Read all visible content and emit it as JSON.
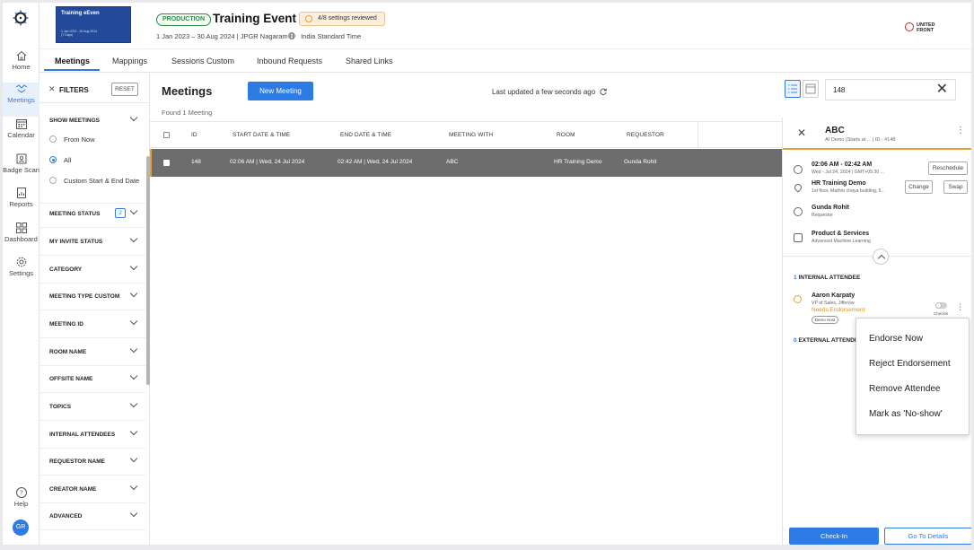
{
  "nav": {
    "items": [
      {
        "label": "Home"
      },
      {
        "label": "Meetings"
      },
      {
        "label": "Calendar"
      },
      {
        "label": "Badge Scan"
      },
      {
        "label": "Reports"
      },
      {
        "label": "Dashboard"
      },
      {
        "label": "Settings"
      }
    ],
    "help": "Help",
    "avatar": "GR"
  },
  "header": {
    "thumb_title": "Training eEven",
    "thumb_dates": "1 Jan 2023 - 30 Aug 2024",
    "thumb_days": "(T Days)",
    "env_badge": "PRODUCTION",
    "event_title": "Training Event",
    "settings_badge": "4/8 settings reviewed",
    "event_sub": "1 Jan 2023 – 30 Aug 2024 | JPGR Nagaram",
    "timezone": "India Standard Time",
    "brand_line1": "UNITED",
    "brand_line2": "FRONT"
  },
  "tabs": [
    {
      "label": "Meetings"
    },
    {
      "label": "Mappings"
    },
    {
      "label": "Sessions Custom"
    },
    {
      "label": "Inbound Requests"
    },
    {
      "label": "Shared Links"
    }
  ],
  "filters": {
    "title": "FILTERS",
    "reset": "RESET",
    "show_meetings": "SHOW MEETINGS",
    "options": [
      "From Now",
      "All",
      "Custom Start & End Date"
    ],
    "meeting_status": "MEETING STATUS",
    "meeting_status_count": "2",
    "rows": [
      "MY INVITE STATUS",
      "CATEGORY",
      "MEETING TYPE CUSTOM",
      "MEETING ID",
      "ROOM NAME",
      "OFFSITE NAME",
      "TOPICS",
      "INTERNAL ATTENDEES",
      "REQUESTOR NAME",
      "CREATOR NAME",
      "ADVANCED"
    ]
  },
  "main": {
    "title": "Meetings",
    "new_button": "New Meeting",
    "updated": "Last updated a few seconds ago",
    "found": "Found 1 Meeting",
    "columns": [
      "ID",
      "START DATE & TIME",
      "END DATE & TIME",
      "MEETING WITH",
      "ROOM",
      "REQUESTOR"
    ],
    "row": {
      "id": "148",
      "start": "02:06 AM | Wed, 24 Jul 2024",
      "end": "02:42 AM | Wed, 24 Jul 2024",
      "with": "ABC",
      "room": "HR Training Demo",
      "requestor": "Gunda Rohit"
    }
  },
  "search": {
    "value": "148"
  },
  "panel": {
    "title": "ABC",
    "sub": "AI Demo (Starts at ... | ID - #148",
    "time": "02:06 AM - 02:42 AM",
    "time_sub": "Wed - Jul 24, 2024 | GMT+05:30 ...",
    "reschedule": "Reschedule",
    "room": "HR Training Demo",
    "room_sub": "1st floor, Mathru chaya building, 5...",
    "change": "Change",
    "swap": "Swap",
    "requestor": "Gunda Rohit",
    "requestor_sub": "Requestor",
    "product": "Product & Services",
    "product_sub": "Advanced Machine Learning",
    "internal_count": "1",
    "internal_label": "INTERNAL ATTENDEE",
    "attendee_name": "Aaron Karpaty",
    "attendee_title": "VP of Sales, Jifferow",
    "attendee_status": "Needs Endorsement",
    "attendee_tag": "Demo Host",
    "checkin_small": "Checkin",
    "external_count": "0",
    "external_label": "EXTERNAL ATTENDEE",
    "checkin_btn": "Check-In",
    "details_btn": "Go To Details"
  },
  "menu": {
    "items": [
      "Endorse Now",
      "Reject Endorsement",
      "Remove Attendee",
      "Mark as 'No-show'"
    ]
  },
  "colors": {
    "accent": "#2d7be5",
    "highlight": "#e2a13a",
    "selected_row": "#6d6d6d",
    "production": "#2c8a3e"
  }
}
